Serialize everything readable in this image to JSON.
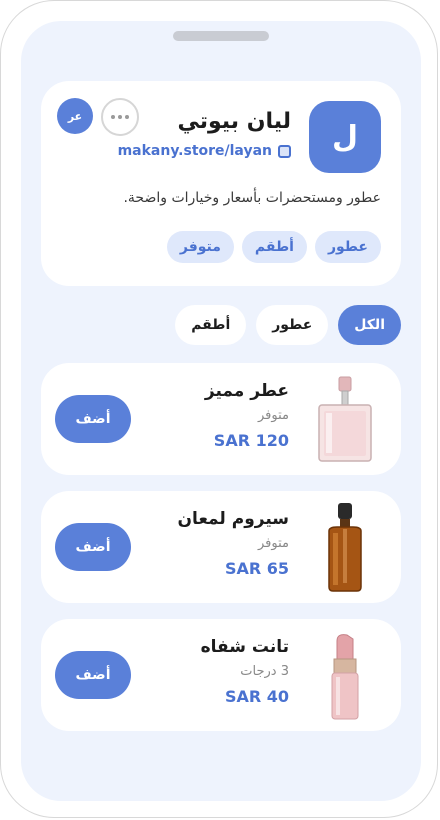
{
  "store": {
    "avatar_letter": "ل",
    "name": "ليان بيوتي",
    "link": "makany.store/layan",
    "lang_label": "عر",
    "description": "عطور ومستحضرات بأسعار وخيارات واضحة.",
    "tags": [
      "عطور",
      "أطقم",
      "متوفر"
    ]
  },
  "filters": [
    "الكل",
    "عطور",
    "أطقم"
  ],
  "active_filter": "الكل",
  "products": [
    {
      "name": "عطر مميز",
      "status": "متوفر",
      "price": "SAR 120",
      "add_label": "أضف",
      "thumb_icon": "perfume-bottle-icon"
    },
    {
      "name": "سيروم لمعان",
      "status": "متوفر",
      "price": "SAR 65",
      "add_label": "أضف",
      "thumb_icon": "serum-bottle-icon"
    },
    {
      "name": "تانت شفاه",
      "status": "3 درجات",
      "price": "SAR 40",
      "add_label": "أضف",
      "thumb_icon": "lipstick-icon"
    }
  ],
  "colors": {
    "accent": "#5a80d9",
    "background": "#eef3fd",
    "tag_bg": "#dfe8fb",
    "price": "#4a72d0"
  }
}
